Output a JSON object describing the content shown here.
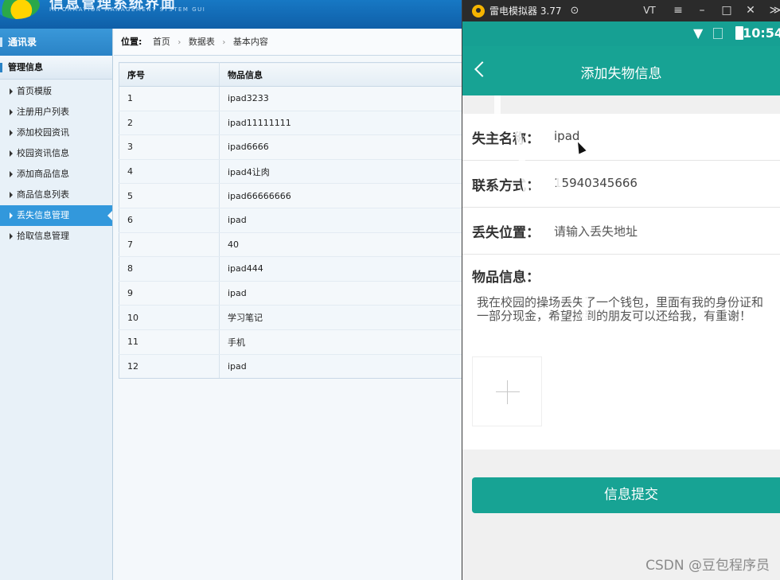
{
  "admin": {
    "banner": {
      "title": "信息管理系统界面",
      "subtitle": "INFORMATION MANAGEMENT SYSTEM GUI"
    },
    "sidebar": {
      "header": "通讯录",
      "section": "管理信息",
      "items": [
        {
          "label": "首页模版"
        },
        {
          "label": "注册用户列表"
        },
        {
          "label": "添加校园资讯"
        },
        {
          "label": "校园资讯信息"
        },
        {
          "label": "添加商品信息"
        },
        {
          "label": "商品信息列表"
        },
        {
          "label": "丢失信息管理"
        },
        {
          "label": "拾取信息管理"
        }
      ]
    },
    "breadcrumb": {
      "label": "位置:",
      "path": [
        "首页",
        "数据表",
        "基本内容"
      ]
    },
    "table": {
      "columns": [
        "序号",
        "物品信息"
      ],
      "rows": [
        [
          "1",
          "ipad3233"
        ],
        [
          "2",
          "ipad11111111"
        ],
        [
          "3",
          "ipad6666"
        ],
        [
          "4",
          "ipad4让肉"
        ],
        [
          "5",
          "ipad66666666"
        ],
        [
          "6",
          "ipad"
        ],
        [
          "7",
          "40"
        ],
        [
          "8",
          "ipad444"
        ],
        [
          "9",
          "ipad"
        ],
        [
          "10",
          "学习笔记"
        ],
        [
          "11",
          "手机"
        ],
        [
          "12",
          "ipad"
        ]
      ]
    }
  },
  "emulator": {
    "window_title": "雷电模拟器 3.77",
    "controls": {
      "vt": "VT",
      "menu": "≡",
      "minimize": "–",
      "maximize": "□",
      "close": "✕",
      "extra": "≫"
    },
    "status": {
      "time": "10:54"
    },
    "app": {
      "title": "添加失物信息",
      "fields": [
        {
          "label": "失主名称：",
          "value": "ipad"
        },
        {
          "label": "联系方式：",
          "value": "15940345666"
        },
        {
          "label": "丢失位置：",
          "placeholder": "请输入丢失地址"
        }
      ],
      "info_label": "物品信息：",
      "info_text": "我在校园的操场丢失了一个钱包，里面有我的身份证和一部分现金，希望捡到的朋友可以还给我，有重谢！",
      "submit": "信息提交"
    },
    "watermark": "CSDN @豆包程序员"
  }
}
